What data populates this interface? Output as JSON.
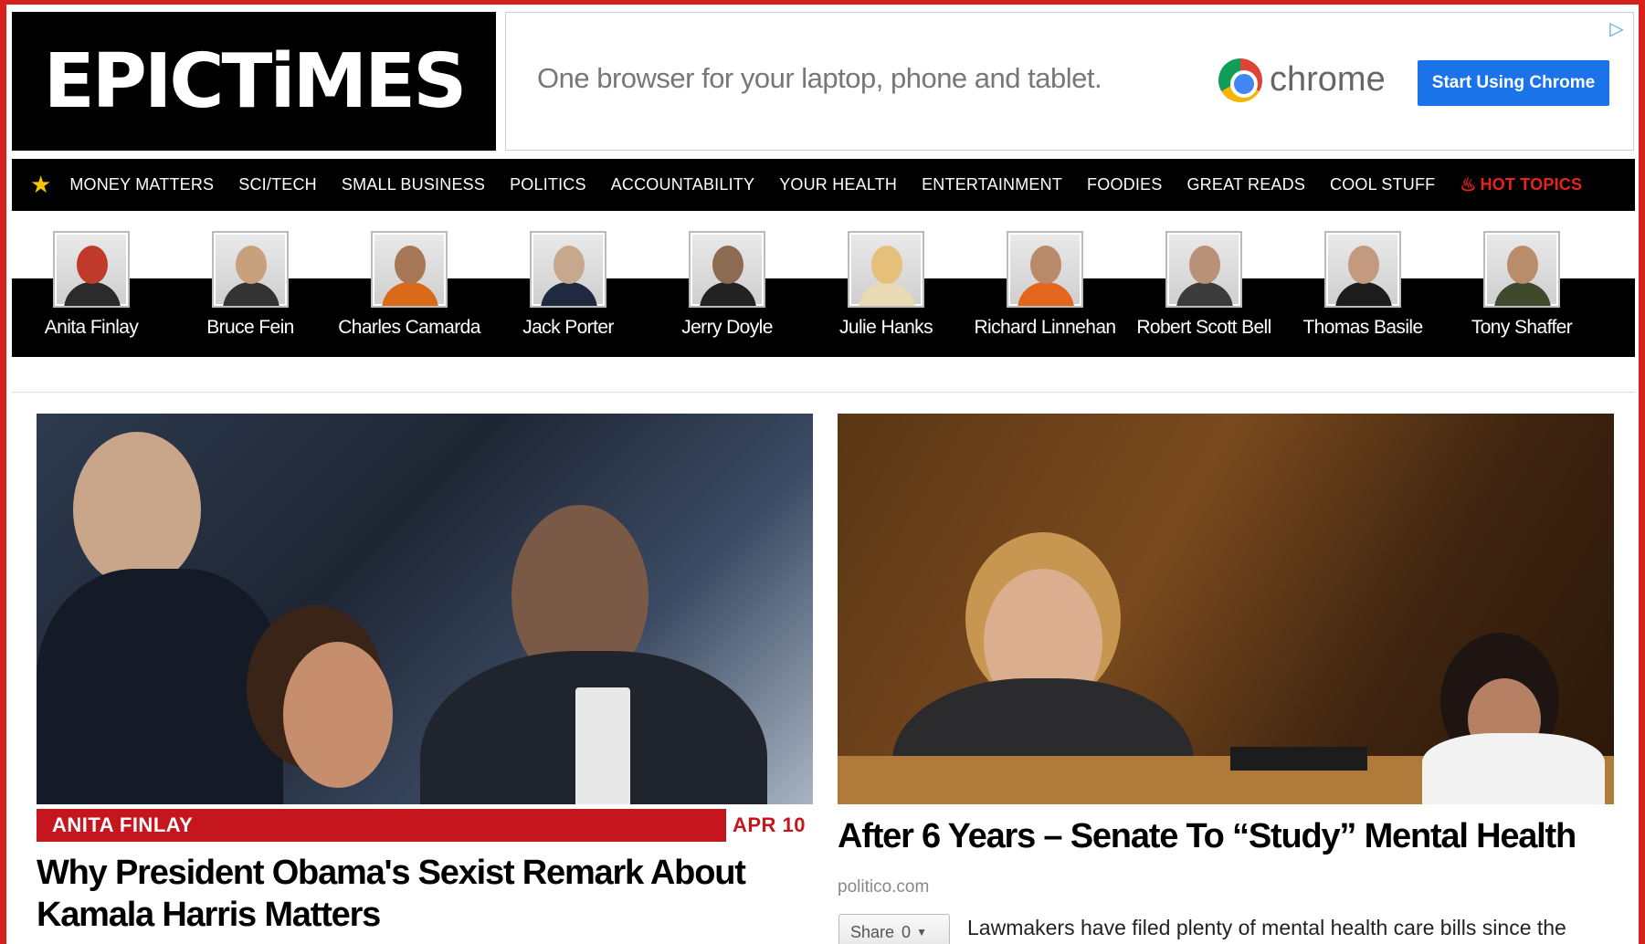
{
  "site": {
    "logo": "EPICTiMES"
  },
  "ad": {
    "tagline": "One browser for your laptop, phone and tablet.",
    "brand": "chrome",
    "cta": "Start Using Chrome"
  },
  "nav": {
    "items": [
      "MONEY MATTERS",
      "SCI/TECH",
      "SMALL BUSINESS",
      "POLITICS",
      "ACCOUNTABILITY",
      "YOUR HEALTH",
      "ENTERTAINMENT",
      "FOODIES",
      "GREAT READS",
      "COOL STUFF"
    ],
    "hot": "HOT TOPICS"
  },
  "columnists": [
    {
      "name": "Anita Finlay"
    },
    {
      "name": "Bruce Fein"
    },
    {
      "name": "Charles Camarda"
    },
    {
      "name": "Jack Porter"
    },
    {
      "name": "Jerry Doyle"
    },
    {
      "name": "Julie Hanks"
    },
    {
      "name": "Richard Linnehan"
    },
    {
      "name": "Robert Scott Bell"
    },
    {
      "name": "Thomas Basile"
    },
    {
      "name": "Tony Shaffer"
    }
  ],
  "stories": {
    "left": {
      "author": "ANITA FINLAY",
      "date": "APR 10",
      "headline": "Why President Obama's Sexist Remark About Kamala Harris Matters"
    },
    "right": {
      "headline": "After 6 Years – Senate To “Study” Mental Health",
      "source": "politico.com",
      "share_label": "Share",
      "share_count": "0",
      "excerpt": "Lawmakers have filed plenty of mental health care bills since the"
    }
  },
  "colors": {
    "brand_red": "#c4161c",
    "nav_bg": "#000000",
    "cta_blue": "#1a73e8"
  }
}
